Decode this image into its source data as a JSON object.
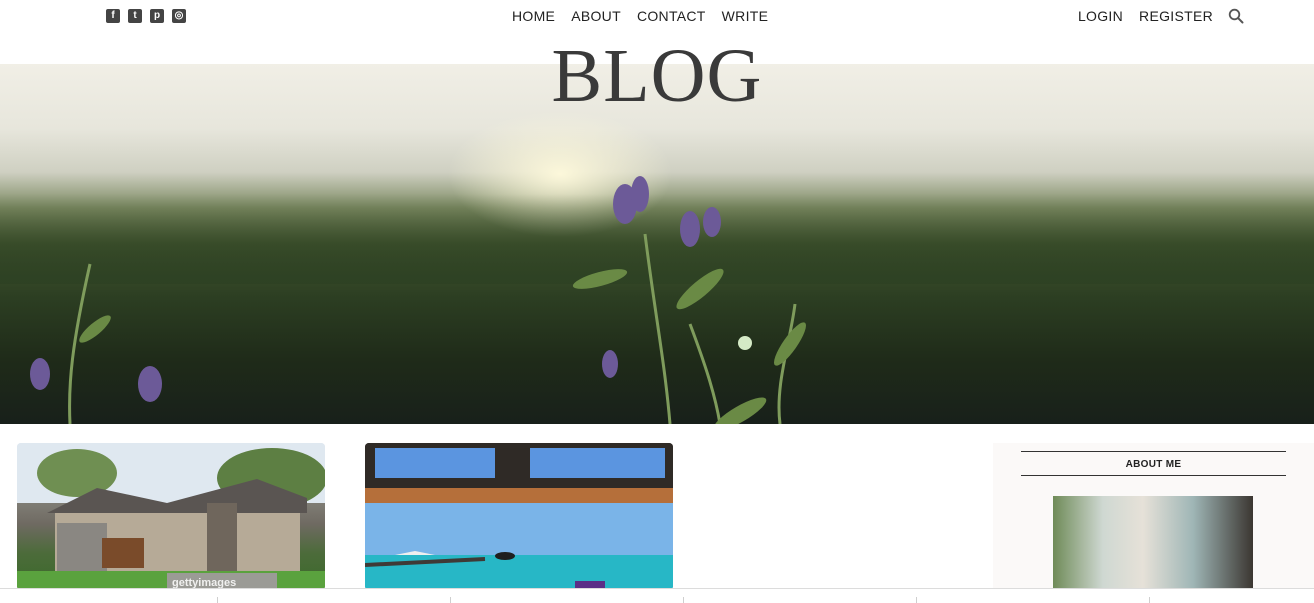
{
  "header": {
    "social": [
      {
        "name": "facebook-icon",
        "glyph": "f"
      },
      {
        "name": "twitter-icon",
        "glyph": "t"
      },
      {
        "name": "pinterest-icon",
        "glyph": "p"
      },
      {
        "name": "instagram-icon",
        "glyph": "◎"
      }
    ],
    "nav": [
      "HOME",
      "ABOUT",
      "CONTACT",
      "WRITE"
    ],
    "auth": [
      "LOGIN",
      "REGISTER"
    ],
    "search_icon": "search-icon"
  },
  "hero": {
    "title": "BLOG"
  },
  "posts": [
    {
      "image": "house-photo",
      "watermark": "gettyimages"
    },
    {
      "image": "pier-ocean-photo"
    }
  ],
  "sidebar": {
    "title": "ABOUT ME",
    "image": "workspace-photo"
  }
}
